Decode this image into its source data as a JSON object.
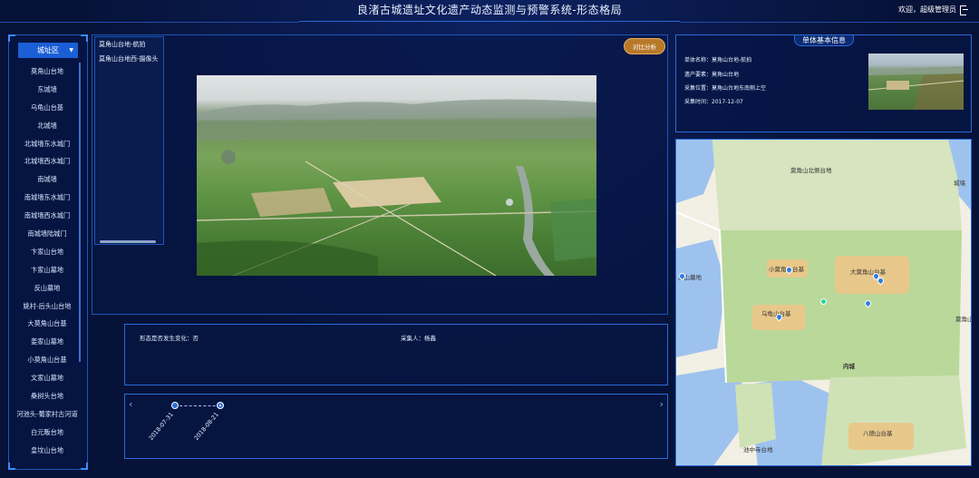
{
  "header": {
    "title": "良渚古城遗址文化遗产动态监测与预警系统-形态格局",
    "user_text": "欢迎，超级管理员"
  },
  "sidebar": {
    "region_label": "城址区",
    "items": [
      "莫角山台地",
      "东城墙",
      "乌龟山台基",
      "北城墙",
      "北城墙东水城门",
      "北城墙西水城门",
      "南城墙",
      "南城墙东水城门",
      "南城墙西水城门",
      "南城墙陆城门",
      "卞家山台地",
      "卞家山墓地",
      "反山墓地",
      "姚村-后头山台地",
      "大莫角山台基",
      "姜家山墓地",
      "小莫角山台基",
      "文家山墓地",
      "桑树头台地",
      "河池头-葡家村古河道",
      "白元畈台地",
      "皇坟山台地"
    ]
  },
  "viewer": {
    "layers": [
      "莫角山台地-航拍",
      "莫角山台地西-摄像头"
    ],
    "compare_button": "对比分析"
  },
  "info": {
    "change_label": "形态是否发生变化：否",
    "collector_label": "采集人：杨鑫"
  },
  "timeline": {
    "dates": [
      "2018-07-31",
      "2018-08-21"
    ]
  },
  "detail": {
    "title": "单体基本信息",
    "name": "单体名称：莫角山台地-航拍",
    "element": "遗产要素：莫角山台地",
    "position": "采集位置：莫角山台地东南侧上空",
    "time": "采集时间：2017-12-07"
  },
  "map": {
    "labels": {
      "top": "莫角山北侧台地",
      "right_top": "城墙",
      "small": "小莫角山台基",
      "big": "大莫角山台基",
      "wugui": "乌龟山台基",
      "inner": "内城",
      "left": "反山墓地",
      "right": "莫角山",
      "bottom_right": "八德山台基",
      "bottom": "池中寺台地"
    }
  },
  "colors": {
    "background": "#061238",
    "panel_border": "#2a6bd8",
    "accent_button": "#b87a2a",
    "select_blue": "#1b5fd6"
  }
}
